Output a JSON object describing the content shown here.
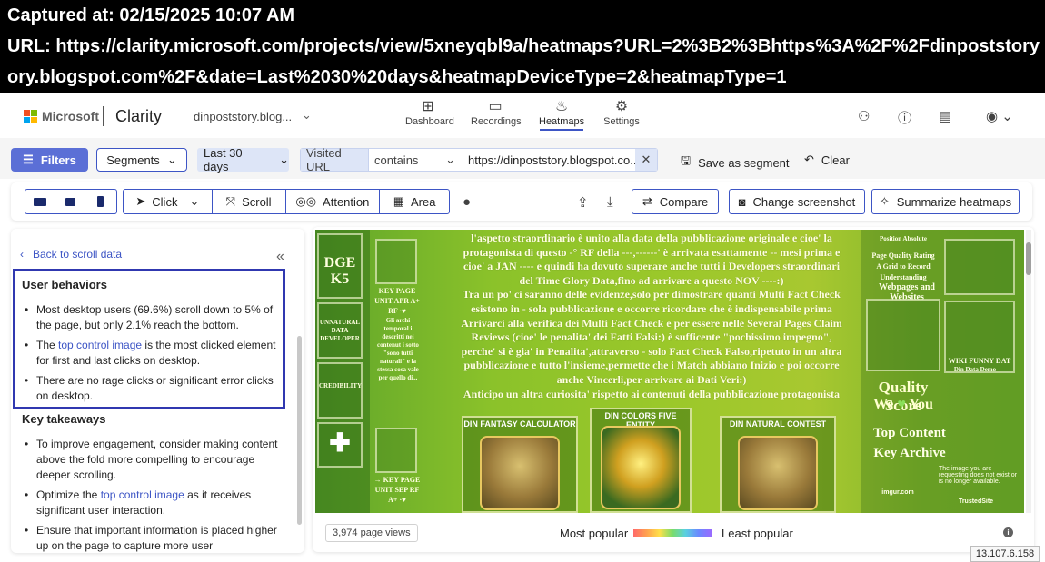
{
  "banner": {
    "captured_at": "Captured at: 02/15/2025 10:07 AM",
    "url_line1": "URL: https://clarity.microsoft.com/projects/view/5xneyqbl9a/heatmaps?URL=2%3B2%3Bhttps%3A%2F%2Fdinpoststory",
    "url_line2": "ory.blogspot.com%2F&date=Last%2030%20days&heatmapDeviceType=2&heatmapType=1"
  },
  "nav": {
    "brand": "Microsoft",
    "product": "Clarity",
    "project": "dinpoststory.blog...",
    "tabs": [
      {
        "label": "Dashboard",
        "icon": "dashboard-icon"
      },
      {
        "label": "Recordings",
        "icon": "video-icon"
      },
      {
        "label": "Heatmaps",
        "icon": "flame-icon"
      },
      {
        "label": "Settings",
        "icon": "gear-icon"
      }
    ],
    "active_tab": "Heatmaps"
  },
  "filters": {
    "filters_label": "Filters",
    "segments_label": "Segments",
    "date_range": "Last 30 days",
    "url_label": "Visited URL",
    "url_operator": "contains",
    "url_value": "https://dinpoststory.blogspot.co...",
    "save_segment": "Save as segment",
    "clear": "Clear"
  },
  "toolbar": {
    "devices": [
      "desktop",
      "tablet",
      "mobile"
    ],
    "selected_device": "tablet",
    "modes": [
      "Click",
      "Scroll",
      "Attention",
      "Area"
    ],
    "selected_mode": "Scroll",
    "compare": "Compare",
    "change_screenshot": "Change screenshot",
    "summarize": "Summarize heatmaps"
  },
  "insights": {
    "back": "Back to scroll data",
    "user_behaviors_title": "User behaviors",
    "behaviors": [
      {
        "pre": "Most desktop users (69.6%) scroll down to 5% of the page, but only 2.1% reach the bottom.",
        "link": "",
        "post": ""
      },
      {
        "pre": "The ",
        "link": "top control image",
        "post": " is the most clicked element for first and last clicks on desktop."
      },
      {
        "pre": "There are no rage clicks or significant error clicks on desktop.",
        "link": "",
        "post": ""
      }
    ],
    "takeaways_title": "Key takeaways",
    "takeaways": [
      {
        "pre": "To improve engagement, consider making content above the fold more compelling to encourage deeper scrolling.",
        "link": "",
        "post": ""
      },
      {
        "pre": "Optimize the ",
        "link": "top control image",
        "post": " as it receives significant user interaction."
      },
      {
        "pre": "Ensure that important information is placed higher up on the page to capture more user",
        "link": "",
        "post": ""
      }
    ]
  },
  "heatmap": {
    "page_text_lines": [
      "l'aspetto straordinario è unito alla data della pubblicazione originale e cioe' la",
      "protagonista di questo -° RF della ---,------' è arrivata esattamente -- mesi prima e",
      "cioe' a JAN ---- e quindi ha dovuto superare anche tutti i Developers straordinari",
      "del Time Glory Data,fino ad arrivare a questo NOV ----:)",
      "Tra un po' ci saranno delle evidenze,solo per dimostrare quanti Multi Fact Check",
      "esistono in - sola pubblicazione e occorre ricordare che è indispensabile prima",
      "Arrivarci alla verifica dei Multi Fact Check e per essere nelle Several Pages Claim",
      "Reviews (cioe' le penalita' dei Fatti Falsi:) è sufficente \"pochissimo impegno\",",
      "perche' si è gia' in Penalita',attraverso - solo Fact Check Falso,ripetuto in un altra",
      "pubblicazione e tutto l'insieme,permette che i Match abbiano Inizio e poi occorre",
      "anche Vincerli,per arrivare ai Dati Veri:)",
      "Anticipo un altra curiosita' rispetto ai contenuti della pubblicazione protagonista"
    ],
    "left_col_texts": [
      "KEY PAGE UNIT APR A+ RF ·♥",
      "Gli archi temporal i descritti nei contenut i sotto \"sono tutti naturali\" e la stessa cosa vale per quello di...",
      "→ KEY PAGE UNIT SEP RF A+ ·♥"
    ],
    "left_tiles": [
      "DGE K5",
      "UNNATURAL DATA DEVELOPER",
      "CREDIBILITY"
    ],
    "widgets": [
      "DIN FANTASY CALCULATOR",
      "DIN COLORS FIVE ENTITY",
      "DIN NATURAL CONTEST"
    ],
    "right_texts": [
      "Position Absolute",
      "Page Quality Rating",
      "A Grid to Record",
      "Understanding",
      "Webpages and Websites",
      "Quality Score",
      "We",
      "You",
      "Top Content",
      "Key Archive",
      "The image you are requesting does not exist or is no longer available.",
      "imgur.com",
      "WIKI FUNNY DAT",
      "Din Data Demo",
      "TrustedSite"
    ],
    "page_views": "3,974 page views",
    "most_popular": "Most popular",
    "least_popular": "Least popular"
  },
  "ip": "13.107.6.158"
}
